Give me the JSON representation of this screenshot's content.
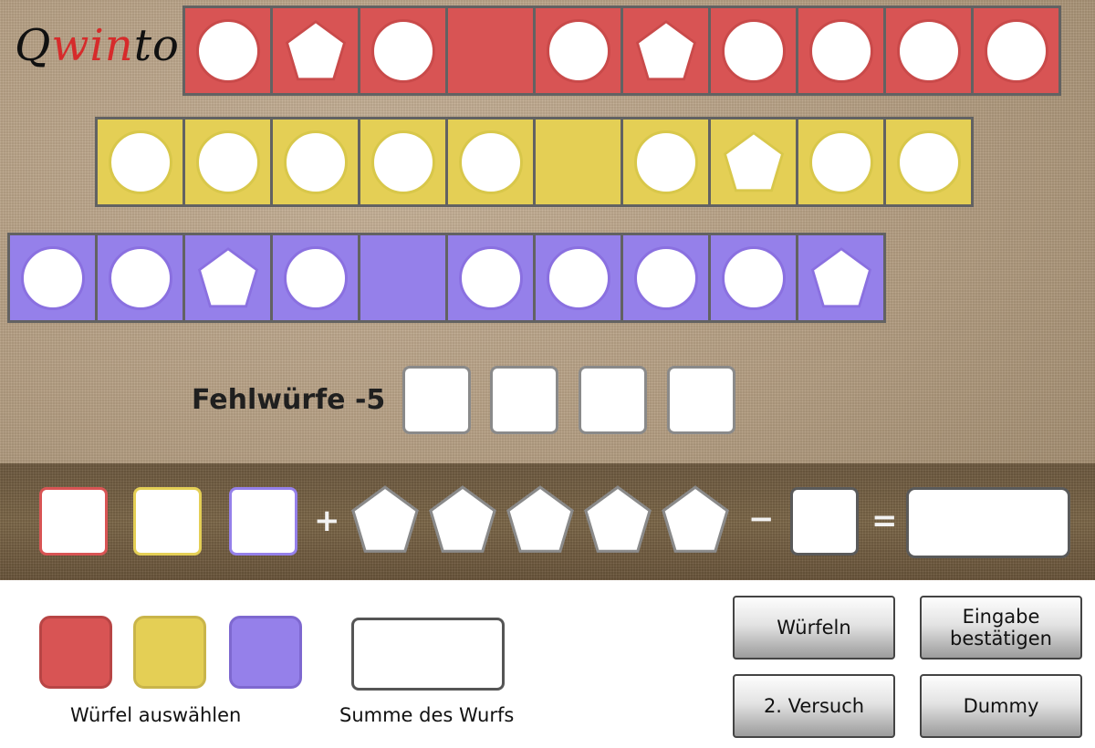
{
  "app": {
    "logo_parts": [
      "Q",
      "win",
      "to"
    ],
    "logo_colors": [
      "#111111",
      "#d62b2b",
      "#111111"
    ]
  },
  "colors": {
    "red": "#d85454",
    "yellow": "#e4cf55",
    "purple": "#9580ea",
    "red_border": "#c94a4a",
    "yellow_border": "#d8c74a",
    "purple_border": "#8a70e0"
  },
  "rows": [
    {
      "color": "red",
      "cells": [
        "circle",
        "pentagon",
        "circle",
        "empty",
        "circle",
        "pentagon",
        "circle",
        "circle",
        "circle",
        "circle"
      ]
    },
    {
      "color": "yellow",
      "cells": [
        "circle",
        "circle",
        "circle",
        "circle",
        "circle",
        "empty",
        "circle",
        "pentagon",
        "circle",
        "circle"
      ]
    },
    {
      "color": "purple",
      "cells": [
        "circle",
        "circle",
        "pentagon",
        "circle",
        "empty",
        "circle",
        "circle",
        "circle",
        "circle",
        "pentagon"
      ]
    }
  ],
  "fehlwuerfe": {
    "label": "Fehlwürfe -5",
    "boxes": 4
  },
  "scoring": {
    "plus": "+",
    "minus": "−",
    "equals": "=",
    "bonus_pentagons": 5
  },
  "dice": {
    "labels": [
      "red-die",
      "yellow-die",
      "purple-die"
    ]
  },
  "labels": {
    "select_dice": "Würfel auswählen",
    "roll_sum": "Summe des Wurfs"
  },
  "buttons": {
    "roll": "Würfeln",
    "confirm_line1": "Eingabe",
    "confirm_line2": "bestätigen",
    "second_try": "2. Versuch",
    "dummy": "Dummy"
  }
}
